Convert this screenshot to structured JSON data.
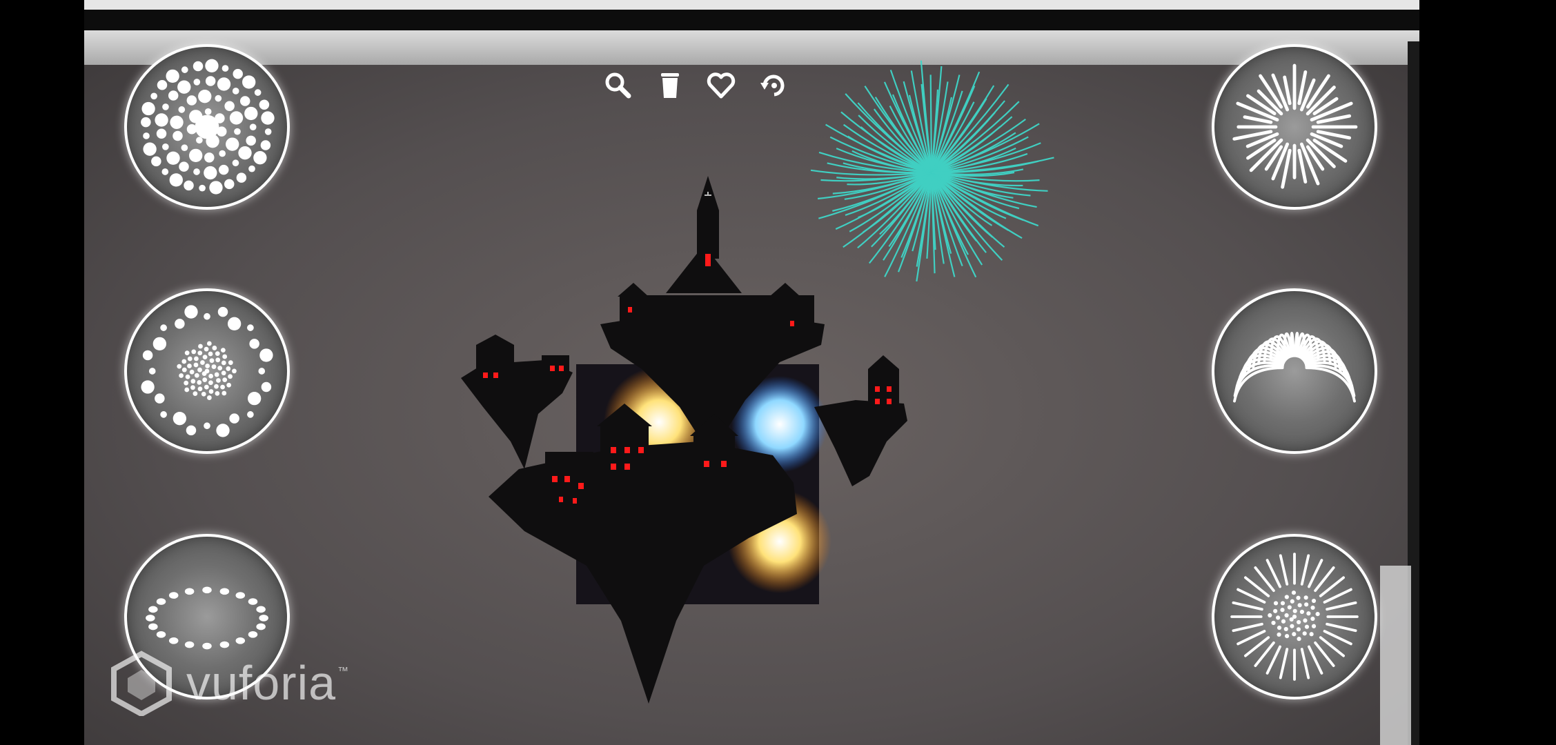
{
  "app": {
    "watermark": {
      "logo_icon": "vuforia-cube-icon",
      "text": "vuforia",
      "trademark": "™"
    }
  },
  "toolbar": {
    "items": [
      {
        "id": "zoom",
        "icon": "magnifier-icon"
      },
      {
        "id": "delete",
        "icon": "trash-icon"
      },
      {
        "id": "favorite",
        "icon": "heart-icon"
      },
      {
        "id": "reset",
        "icon": "rotate-icon"
      }
    ]
  },
  "firework_buttons": {
    "left": [
      {
        "id": "dots-burst",
        "icon": "dots-burst-icon"
      },
      {
        "id": "ring-burst",
        "icon": "ring-burst-icon"
      },
      {
        "id": "oval-ring",
        "icon": "oval-ring-icon"
      }
    ],
    "right": [
      {
        "id": "line-burst",
        "icon": "line-burst-icon"
      },
      {
        "id": "willow-burst",
        "icon": "willow-burst-icon"
      },
      {
        "id": "peony-burst",
        "icon": "peony-burst-icon"
      }
    ]
  },
  "colors": {
    "button_border": "#ffffff",
    "button_fill": "#808080",
    "firework_teal": "#3fd6c8",
    "window_red": "#ff1a1a",
    "background_gray": "#5a5656"
  }
}
